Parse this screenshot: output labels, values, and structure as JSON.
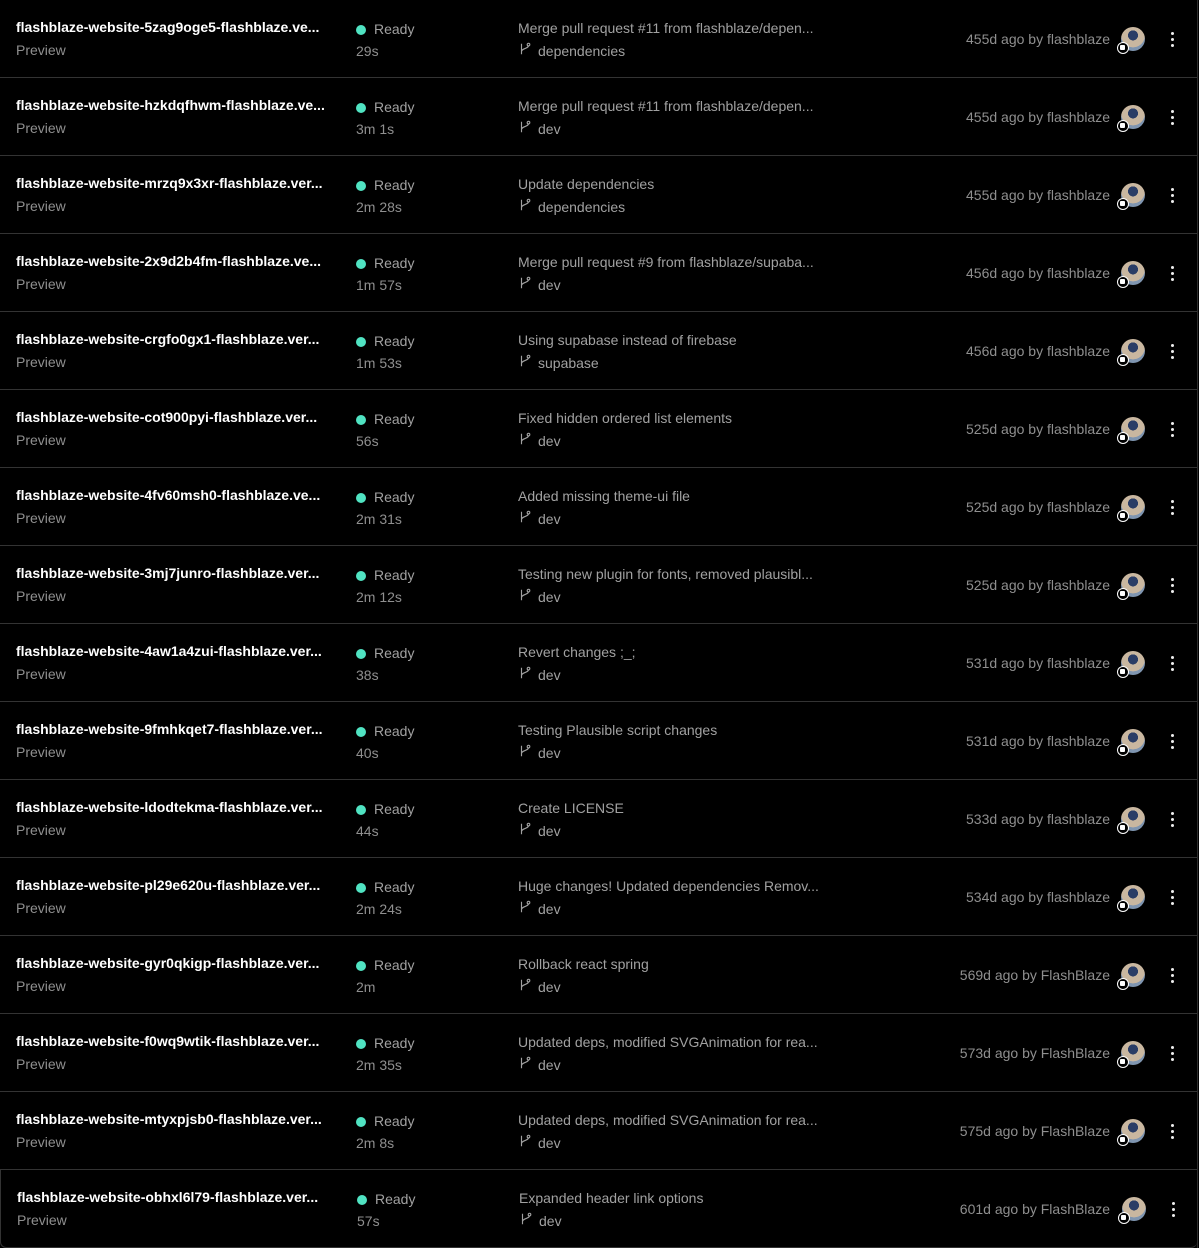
{
  "status_color": "#50e3c2",
  "deployments": [
    {
      "name": "flashblaze-website-5zag9oge5-flashblaze.ve...",
      "env": "Preview",
      "status": "Ready",
      "duration": "29s",
      "commit": "Merge pull request #11 from flashblaze/depen...",
      "branch": "dependencies",
      "time": "455d ago by flashblaze"
    },
    {
      "name": "flashblaze-website-hzkdqfhwm-flashblaze.ve...",
      "env": "Preview",
      "status": "Ready",
      "duration": "3m 1s",
      "commit": "Merge pull request #11 from flashblaze/depen...",
      "branch": "dev",
      "time": "455d ago by flashblaze"
    },
    {
      "name": "flashblaze-website-mrzq9x3xr-flashblaze.ver...",
      "env": "Preview",
      "status": "Ready",
      "duration": "2m 28s",
      "commit": "Update dependencies",
      "branch": "dependencies",
      "time": "455d ago by flashblaze"
    },
    {
      "name": "flashblaze-website-2x9d2b4fm-flashblaze.ve...",
      "env": "Preview",
      "status": "Ready",
      "duration": "1m 57s",
      "commit": "Merge pull request #9 from flashblaze/supaba...",
      "branch": "dev",
      "time": "456d ago by flashblaze"
    },
    {
      "name": "flashblaze-website-crgfo0gx1-flashblaze.ver...",
      "env": "Preview",
      "status": "Ready",
      "duration": "1m 53s",
      "commit": "Using supabase instead of firebase",
      "branch": "supabase",
      "time": "456d ago by flashblaze"
    },
    {
      "name": "flashblaze-website-cot900pyi-flashblaze.ver...",
      "env": "Preview",
      "status": "Ready",
      "duration": "56s",
      "commit": "Fixed hidden ordered list elements",
      "branch": "dev",
      "time": "525d ago by flashblaze"
    },
    {
      "name": "flashblaze-website-4fv60msh0-flashblaze.ve...",
      "env": "Preview",
      "status": "Ready",
      "duration": "2m 31s",
      "commit": "Added missing theme-ui file",
      "branch": "dev",
      "time": "525d ago by flashblaze"
    },
    {
      "name": "flashblaze-website-3mj7junro-flashblaze.ver...",
      "env": "Preview",
      "status": "Ready",
      "duration": "2m 12s",
      "commit": "Testing new plugin for fonts, removed plausibl...",
      "branch": "dev",
      "time": "525d ago by flashblaze"
    },
    {
      "name": "flashblaze-website-4aw1a4zui-flashblaze.ver...",
      "env": "Preview",
      "status": "Ready",
      "duration": "38s",
      "commit": "Revert changes ;_;",
      "branch": "dev",
      "time": "531d ago by flashblaze"
    },
    {
      "name": "flashblaze-website-9fmhkqet7-flashblaze.ver...",
      "env": "Preview",
      "status": "Ready",
      "duration": "40s",
      "commit": "Testing Plausible script changes",
      "branch": "dev",
      "time": "531d ago by flashblaze"
    },
    {
      "name": "flashblaze-website-ldodtekma-flashblaze.ver...",
      "env": "Preview",
      "status": "Ready",
      "duration": "44s",
      "commit": "Create LICENSE",
      "branch": "dev",
      "time": "533d ago by flashblaze"
    },
    {
      "name": "flashblaze-website-pl29e620u-flashblaze.ver...",
      "env": "Preview",
      "status": "Ready",
      "duration": "2m 24s",
      "commit": "Huge changes! Updated dependencies Remov...",
      "branch": "dev",
      "time": "534d ago by flashblaze"
    },
    {
      "name": "flashblaze-website-gyr0qkigp-flashblaze.ver...",
      "env": "Preview",
      "status": "Ready",
      "duration": "2m",
      "commit": "Rollback react spring",
      "branch": "dev",
      "time": "569d ago by FlashBlaze"
    },
    {
      "name": "flashblaze-website-f0wq9wtik-flashblaze.ver...",
      "env": "Preview",
      "status": "Ready",
      "duration": "2m 35s",
      "commit": "Updated deps, modified SVGAnimation for rea...",
      "branch": "dev",
      "time": "573d ago by FlashBlaze"
    },
    {
      "name": "flashblaze-website-mtyxpjsb0-flashblaze.ver...",
      "env": "Preview",
      "status": "Ready",
      "duration": "2m 8s",
      "commit": "Updated deps, modified SVGAnimation for rea...",
      "branch": "dev",
      "time": "575d ago by FlashBlaze"
    },
    {
      "name": "flashblaze-website-obhxl6l79-flashblaze.ver...",
      "env": "Preview",
      "status": "Ready",
      "duration": "57s",
      "commit": "Expanded header link options",
      "branch": "dev",
      "time": "601d ago by FlashBlaze"
    }
  ]
}
